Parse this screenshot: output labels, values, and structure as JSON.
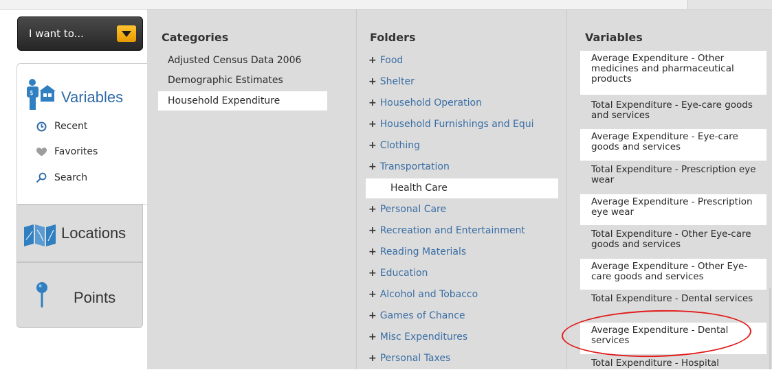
{
  "header": {
    "want_label": "I want to..."
  },
  "leftnav": {
    "variables": {
      "title": "Variables",
      "items": [
        {
          "label": "Recent",
          "icon": "clock-icon"
        },
        {
          "label": "Favorites",
          "icon": "heart-icon"
        },
        {
          "label": "Search",
          "icon": "search-icon"
        }
      ]
    },
    "locations": {
      "title": "Locations"
    },
    "points": {
      "title": "Points"
    }
  },
  "categories": {
    "heading": "Categories",
    "items": [
      {
        "label": "Adjusted Census Data 2006",
        "selected": false
      },
      {
        "label": "Demographic Estimates",
        "selected": false
      },
      {
        "label": "Household Expenditure",
        "selected": true
      }
    ]
  },
  "folders": {
    "heading": "Folders",
    "items": [
      {
        "label": "Food",
        "plus": "+",
        "selected": false
      },
      {
        "label": "Shelter",
        "plus": "+",
        "selected": false
      },
      {
        "label": "Household Operation",
        "plus": "+",
        "selected": false
      },
      {
        "label": "Household Furnishings and Equi",
        "plus": "+",
        "selected": false
      },
      {
        "label": "Clothing",
        "plus": "+",
        "selected": false
      },
      {
        "label": "Transportation",
        "plus": "+",
        "selected": false
      },
      {
        "label": "Health Care",
        "plus": "",
        "selected": true
      },
      {
        "label": "Personal Care",
        "plus": "+",
        "selected": false
      },
      {
        "label": "Recreation and Entertainment",
        "plus": "+",
        "selected": false
      },
      {
        "label": "Reading Materials",
        "plus": "+",
        "selected": false
      },
      {
        "label": "Education",
        "plus": "+",
        "selected": false
      },
      {
        "label": "Alcohol and Tobacco",
        "plus": "+",
        "selected": false
      },
      {
        "label": "Games of Chance",
        "plus": "+",
        "selected": false
      },
      {
        "label": "Misc Expenditures",
        "plus": "+",
        "selected": false
      },
      {
        "label": "Personal Taxes",
        "plus": "+",
        "selected": false
      }
    ]
  },
  "variables": {
    "heading": "Variables",
    "items": [
      {
        "label": "Average Expenditure - Other medicines and pharmaceutical products"
      },
      {
        "label": "Total Expenditure - Eye-care goods and services"
      },
      {
        "label": "Average Expenditure - Eye-care goods and services"
      },
      {
        "label": "Total Expenditure - Prescription eye wear"
      },
      {
        "label": "Average Expenditure - Prescription eye wear"
      },
      {
        "label": "Total Expenditure - Other Eye-care goods and services"
      },
      {
        "label": "Average Expenditure - Other Eye-care goods and services"
      },
      {
        "label": "Total Expenditure - Dental services"
      },
      {
        "label": "Average Expenditure - Dental services"
      },
      {
        "label": "Total Expenditure - Hospital"
      }
    ]
  },
  "colors": {
    "accent": "#2f6aa8",
    "highlight_oval": "#e21b1b",
    "dropdown": "#f5a800"
  }
}
